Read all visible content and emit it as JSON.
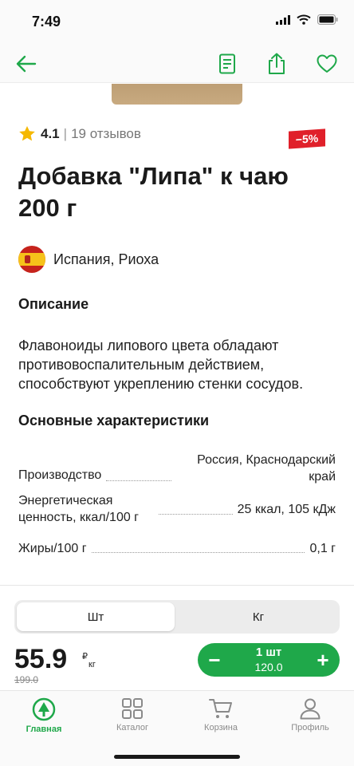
{
  "status_bar": {
    "time": "7:49"
  },
  "top_bar": {
    "back_icon": "arrow-left-icon",
    "actions": [
      "document-icon",
      "share-icon",
      "heart-icon"
    ]
  },
  "product": {
    "rating": "4.1",
    "reviews": "19 отзывов",
    "discount": "−5%",
    "title": "Добавка \"Липа\" к чаю 200 г",
    "origin": "Испания, Риоха",
    "description_heading": "Описание",
    "description": "Флавоноиды липового цвета обладают противовоспалительным действием, способствуют укреплению стенки сосудов.",
    "specs_heading": "Основные характеристики",
    "specs": [
      {
        "label": "Производство",
        "value": "Россия, Краснодарский край"
      },
      {
        "label": "Энергетическая ценность, ккал/100 г",
        "value": "25 ккал, 105 кДж"
      },
      {
        "label": "Жиры/100 г",
        "value": "0,1 г"
      }
    ]
  },
  "purchase": {
    "unit_options": [
      "Шт",
      "Кг"
    ],
    "selected_unit": "Шт",
    "price": "55.9",
    "price_unit_top": "₽",
    "price_unit_bottom": "кг",
    "old_price": "199.0",
    "quantity": "1 шт",
    "total": "120.0",
    "minus": "−",
    "plus": "+"
  },
  "tabs": [
    {
      "label": "Главная",
      "icon": "home-logo-icon",
      "active": true
    },
    {
      "label": "Каталог",
      "icon": "grid-icon",
      "active": false
    },
    {
      "label": "Корзина",
      "icon": "cart-icon",
      "active": false
    },
    {
      "label": "Профиль",
      "icon": "user-icon",
      "active": false
    }
  ],
  "colors": {
    "accent": "#1fa84a",
    "discount": "#e0202a",
    "star": "#f5b800"
  }
}
